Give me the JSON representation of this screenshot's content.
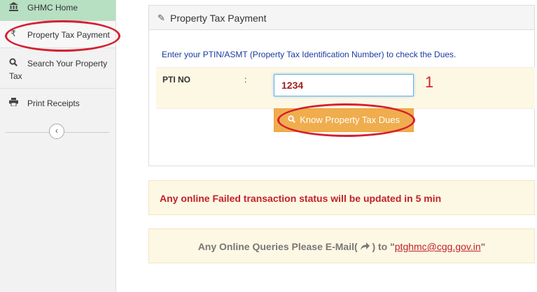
{
  "sidebar": {
    "items": [
      {
        "label": "GHMC Home",
        "icon": "bank-icon"
      },
      {
        "label": "Property Tax Payment",
        "icon": "rupee-icon"
      },
      {
        "label": "Search Your Property Tax",
        "icon": "search-icon"
      },
      {
        "label": "Print Receipts",
        "icon": "print-icon"
      }
    ],
    "collapse_icon": "chevron-left-icon"
  },
  "panel": {
    "title": "Property Tax Payment",
    "title_icon": "edit-icon",
    "info": "Enter your PTIN/ASMT (Property Tax Identification Number) to check the Dues.",
    "pti_label": "PTI NO",
    "colon": ":",
    "pti_value": "1234",
    "step_number": "1",
    "button_label": "Know Property Tax Dues",
    "button_icon": "search-icon"
  },
  "alert": {
    "text": "Any online Failed transaction status will be updated in 5 min"
  },
  "contact": {
    "prefix": "Any Online Queries Please E-Mail",
    "icon": "share-arrow-icon",
    "to": " to \"",
    "email": "ptghmc@cgg.gov.in",
    "suffix": "\""
  },
  "colors": {
    "annotation_red": "#d42030",
    "home_bg": "#b7dfc2",
    "button_orange": "#f0ad4e",
    "alert_red": "#c12228",
    "info_blue": "#1a3aa0"
  }
}
